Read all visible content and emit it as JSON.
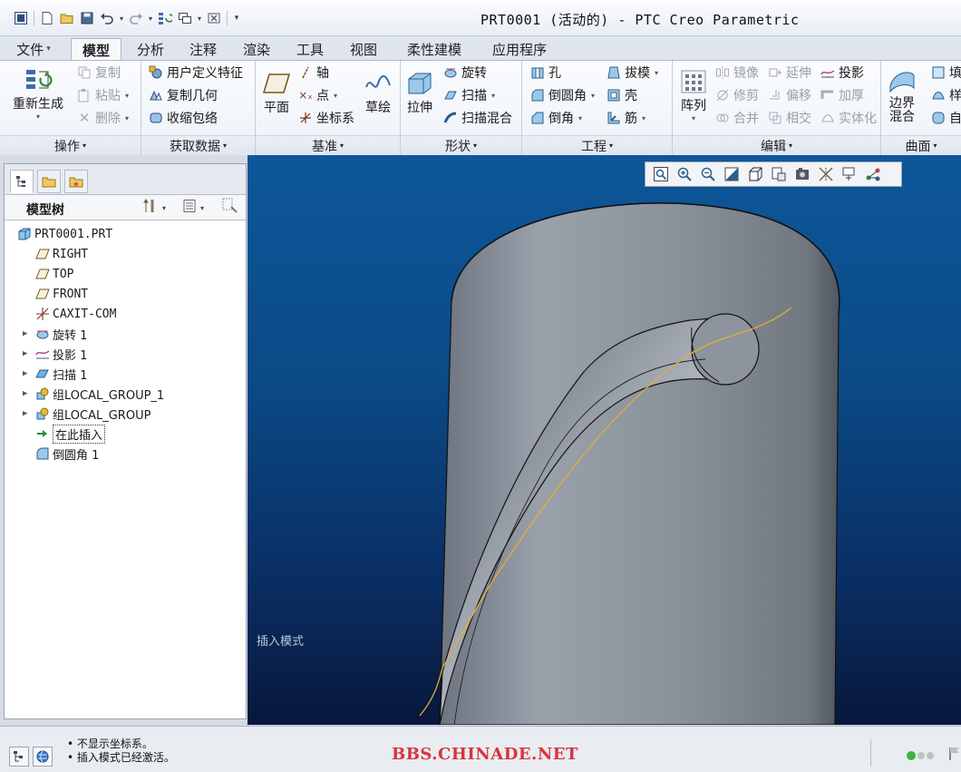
{
  "window": {
    "title": "PRT0001 (活动的) - PTC Creo Parametric"
  },
  "tabs": [
    {
      "label": "文件",
      "dropdown": true
    },
    {
      "label": "模型",
      "active": true
    },
    {
      "label": "分析"
    },
    {
      "label": "注释"
    },
    {
      "label": "渲染"
    },
    {
      "label": "工具"
    },
    {
      "label": "视图"
    },
    {
      "label": "柔性建模"
    },
    {
      "label": "应用程序"
    }
  ],
  "ribbon": {
    "operations": {
      "title": "操作",
      "regenerate": "重新生成",
      "copy": "复制",
      "paste": "粘贴",
      "delete": "删除"
    },
    "get_data": {
      "title": "获取数据",
      "udf": "用户定义特征",
      "copy_geom": "复制几何",
      "shrinkwrap": "收缩包络"
    },
    "datum": {
      "title": "基准",
      "plane": "平面",
      "axis": "轴",
      "point": "点",
      "csys": "坐标系",
      "sketch": "草绘"
    },
    "shapes": {
      "title": "形状",
      "extrude": "拉伸",
      "revolve": "旋转",
      "sweep": "扫描",
      "swept_blend": "扫描混合"
    },
    "engineering": {
      "title": "工程",
      "hole": "孔",
      "round": "倒圆角",
      "chamfer": "倒角",
      "draft": "拔模",
      "shell": "壳",
      "rib": "筋"
    },
    "editing": {
      "title": "编辑",
      "pattern": "阵列",
      "mirror": "镜像",
      "trim": "修剪",
      "merge": "合并",
      "extend": "延伸",
      "offset": "偏移",
      "intersect": "相交",
      "project": "投影",
      "thicken": "加厚",
      "solidify": "实体化"
    },
    "surfaces": {
      "title": "曲面",
      "boundary_blend": "边界\n混合",
      "fill": "填",
      "style": "样",
      "free": "自"
    }
  },
  "tree": {
    "title": "模型树",
    "items": [
      {
        "label": "PRT0001.PRT",
        "icon": "part-icon",
        "indent": 0,
        "expandable": false
      },
      {
        "label": "RIGHT",
        "icon": "datum-plane-icon",
        "indent": 1,
        "expandable": false
      },
      {
        "label": "TOP",
        "icon": "datum-plane-icon",
        "indent": 1,
        "expandable": false
      },
      {
        "label": "FRONT",
        "icon": "datum-plane-icon",
        "indent": 1,
        "expandable": false
      },
      {
        "label": "CAXIT-COM",
        "icon": "csys-icon",
        "indent": 1,
        "expandable": false
      },
      {
        "label": "旋转 1",
        "icon": "revolve-icon",
        "indent": 1,
        "expandable": true
      },
      {
        "label": "投影 1",
        "icon": "project-icon",
        "indent": 1,
        "expandable": true
      },
      {
        "label": "扫描 1",
        "icon": "sweep-icon",
        "indent": 1,
        "expandable": true
      },
      {
        "label": "组LOCAL_GROUP_1",
        "icon": "group-icon",
        "indent": 1,
        "expandable": true
      },
      {
        "label": "组LOCAL_GROUP",
        "icon": "group-icon",
        "indent": 1,
        "expandable": true
      },
      {
        "label": "在此插入",
        "icon": "insert-arrow-icon",
        "indent": 1,
        "expandable": false
      },
      {
        "label": "倒圆角 1",
        "icon": "round-icon",
        "indent": 1,
        "expandable": false
      }
    ]
  },
  "viewport": {
    "mode_text": "插入模式"
  },
  "status": {
    "messages": [
      "不显示坐标系。",
      "插入模式已经激活。"
    ],
    "watermark": "BBS.CHINADE.NET"
  }
}
